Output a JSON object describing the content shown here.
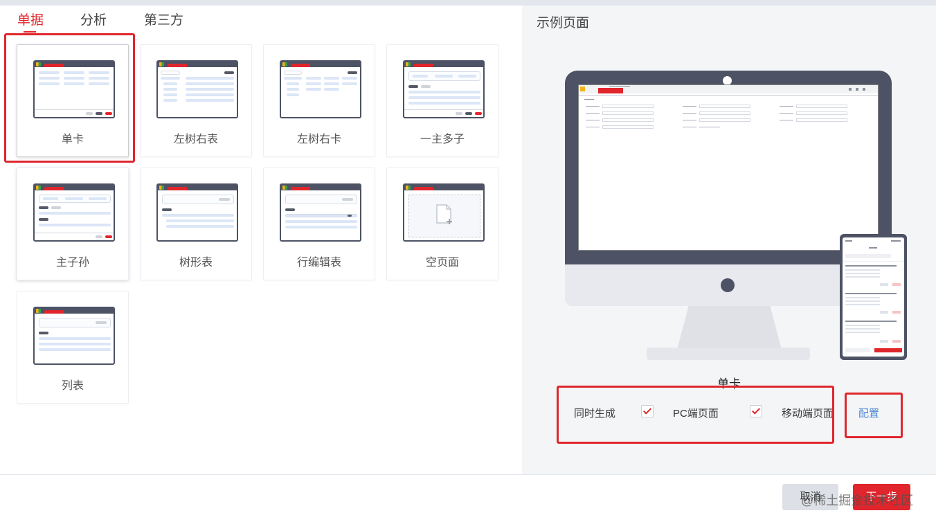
{
  "tabs": [
    {
      "label": "单据",
      "active": true
    },
    {
      "label": "分析",
      "active": false
    },
    {
      "label": "第三方",
      "active": false
    }
  ],
  "templates": [
    {
      "label": "单卡",
      "selected": true
    },
    {
      "label": "左树右表"
    },
    {
      "label": "左树右卡"
    },
    {
      "label": "一主多子"
    },
    {
      "label": "主子孙"
    },
    {
      "label": "树形表"
    },
    {
      "label": "行编辑表"
    },
    {
      "label": "空页面"
    },
    {
      "label": "列表"
    }
  ],
  "preview": {
    "title": "示例页面",
    "template_name": "单卡",
    "options": {
      "generate_label": "同时生成",
      "pc_label": "PC端页面",
      "pc_checked": true,
      "mobile_label": "移动端页面",
      "mobile_checked": true,
      "config_link": "配置"
    }
  },
  "footer": {
    "cancel": "取消",
    "next": "下一步"
  },
  "watermark": "@稀土掘金技术社区",
  "colors": {
    "accent": "#e0262c",
    "link": "#4a86d4",
    "frame": "#4d5265"
  }
}
